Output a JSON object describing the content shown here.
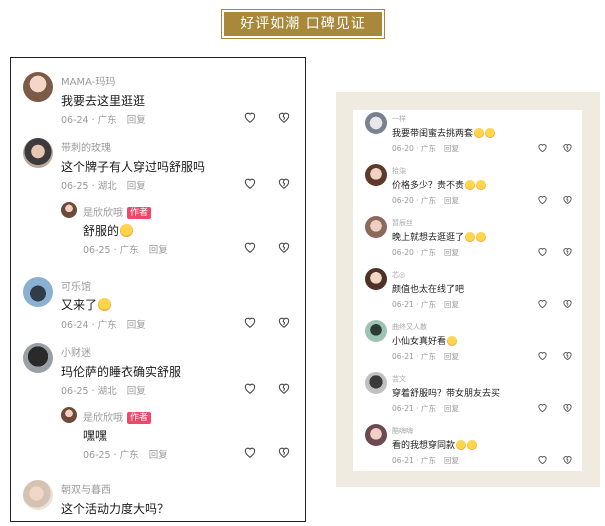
{
  "banner": {
    "text": "好评如潮  口碑见证"
  },
  "left_comments": [
    {
      "user": "MAMA-玛玛",
      "text": "我要去这里逛逛",
      "date": "06-24",
      "region": "广东",
      "reply": "回复"
    },
    {
      "user": "带刺的玫瑰",
      "text": "这个牌子有人穿过吗舒服吗",
      "date": "06-25",
      "region": "湖北",
      "reply": "回复"
    },
    {
      "user": "是欣欣哦",
      "badge": "作者",
      "text": "舒服的",
      "date": "06-25",
      "region": "广东",
      "reply": "回复"
    },
    {
      "user": "可乐馆",
      "text": "又来了",
      "date": "06-24",
      "region": "广东",
      "reply": "回复"
    },
    {
      "user": "小财迷",
      "text": "玛伦萨的睡衣确实舒服",
      "date": "06-25",
      "region": "湖北",
      "reply": "回复"
    },
    {
      "user": "是欣欣哦",
      "badge": "作者",
      "text": "嘿嘿",
      "date": "06-25",
      "region": "广东",
      "reply": "回复"
    },
    {
      "user": "朝双与暮西",
      "text": "这个活动力度大吗？"
    }
  ],
  "right_comments": [
    {
      "user": "一样",
      "text": "我要带闺蜜去挑两套",
      "date": "06-20",
      "region": "广东",
      "reply": "回复"
    },
    {
      "user": "拾柒",
      "text": "价格多少？贵不贵",
      "date": "06-20",
      "region": "广东",
      "reply": "回复"
    },
    {
      "user": "暂辰丝",
      "text": "晚上就想去逛逛了",
      "date": "06-20",
      "region": "广东",
      "reply": "回复"
    },
    {
      "user": "芯◎",
      "text": "颜值也太在线了吧",
      "date": "06-21",
      "region": "广东",
      "reply": "回复"
    },
    {
      "user": "曲终又人散",
      "text": "小仙女真好看",
      "date": "06-21",
      "region": "广东",
      "reply": "回复"
    },
    {
      "user": "芸文",
      "text": "穿着舒服吗？带女朋友去买",
      "date": "06-21",
      "region": "广东",
      "reply": "回复"
    },
    {
      "user": "酷嗨嗨",
      "text": "看的我想穿同款",
      "date": "06-21",
      "region": "广东",
      "reply": "回复"
    }
  ],
  "icons": {
    "like": "heart-outline-icon",
    "dislike": "broken-heart-outline-icon"
  },
  "colors": {
    "banner": "#a8883a",
    "author_badge": "#f0466a",
    "panel_bg": "#f0ebe1"
  }
}
